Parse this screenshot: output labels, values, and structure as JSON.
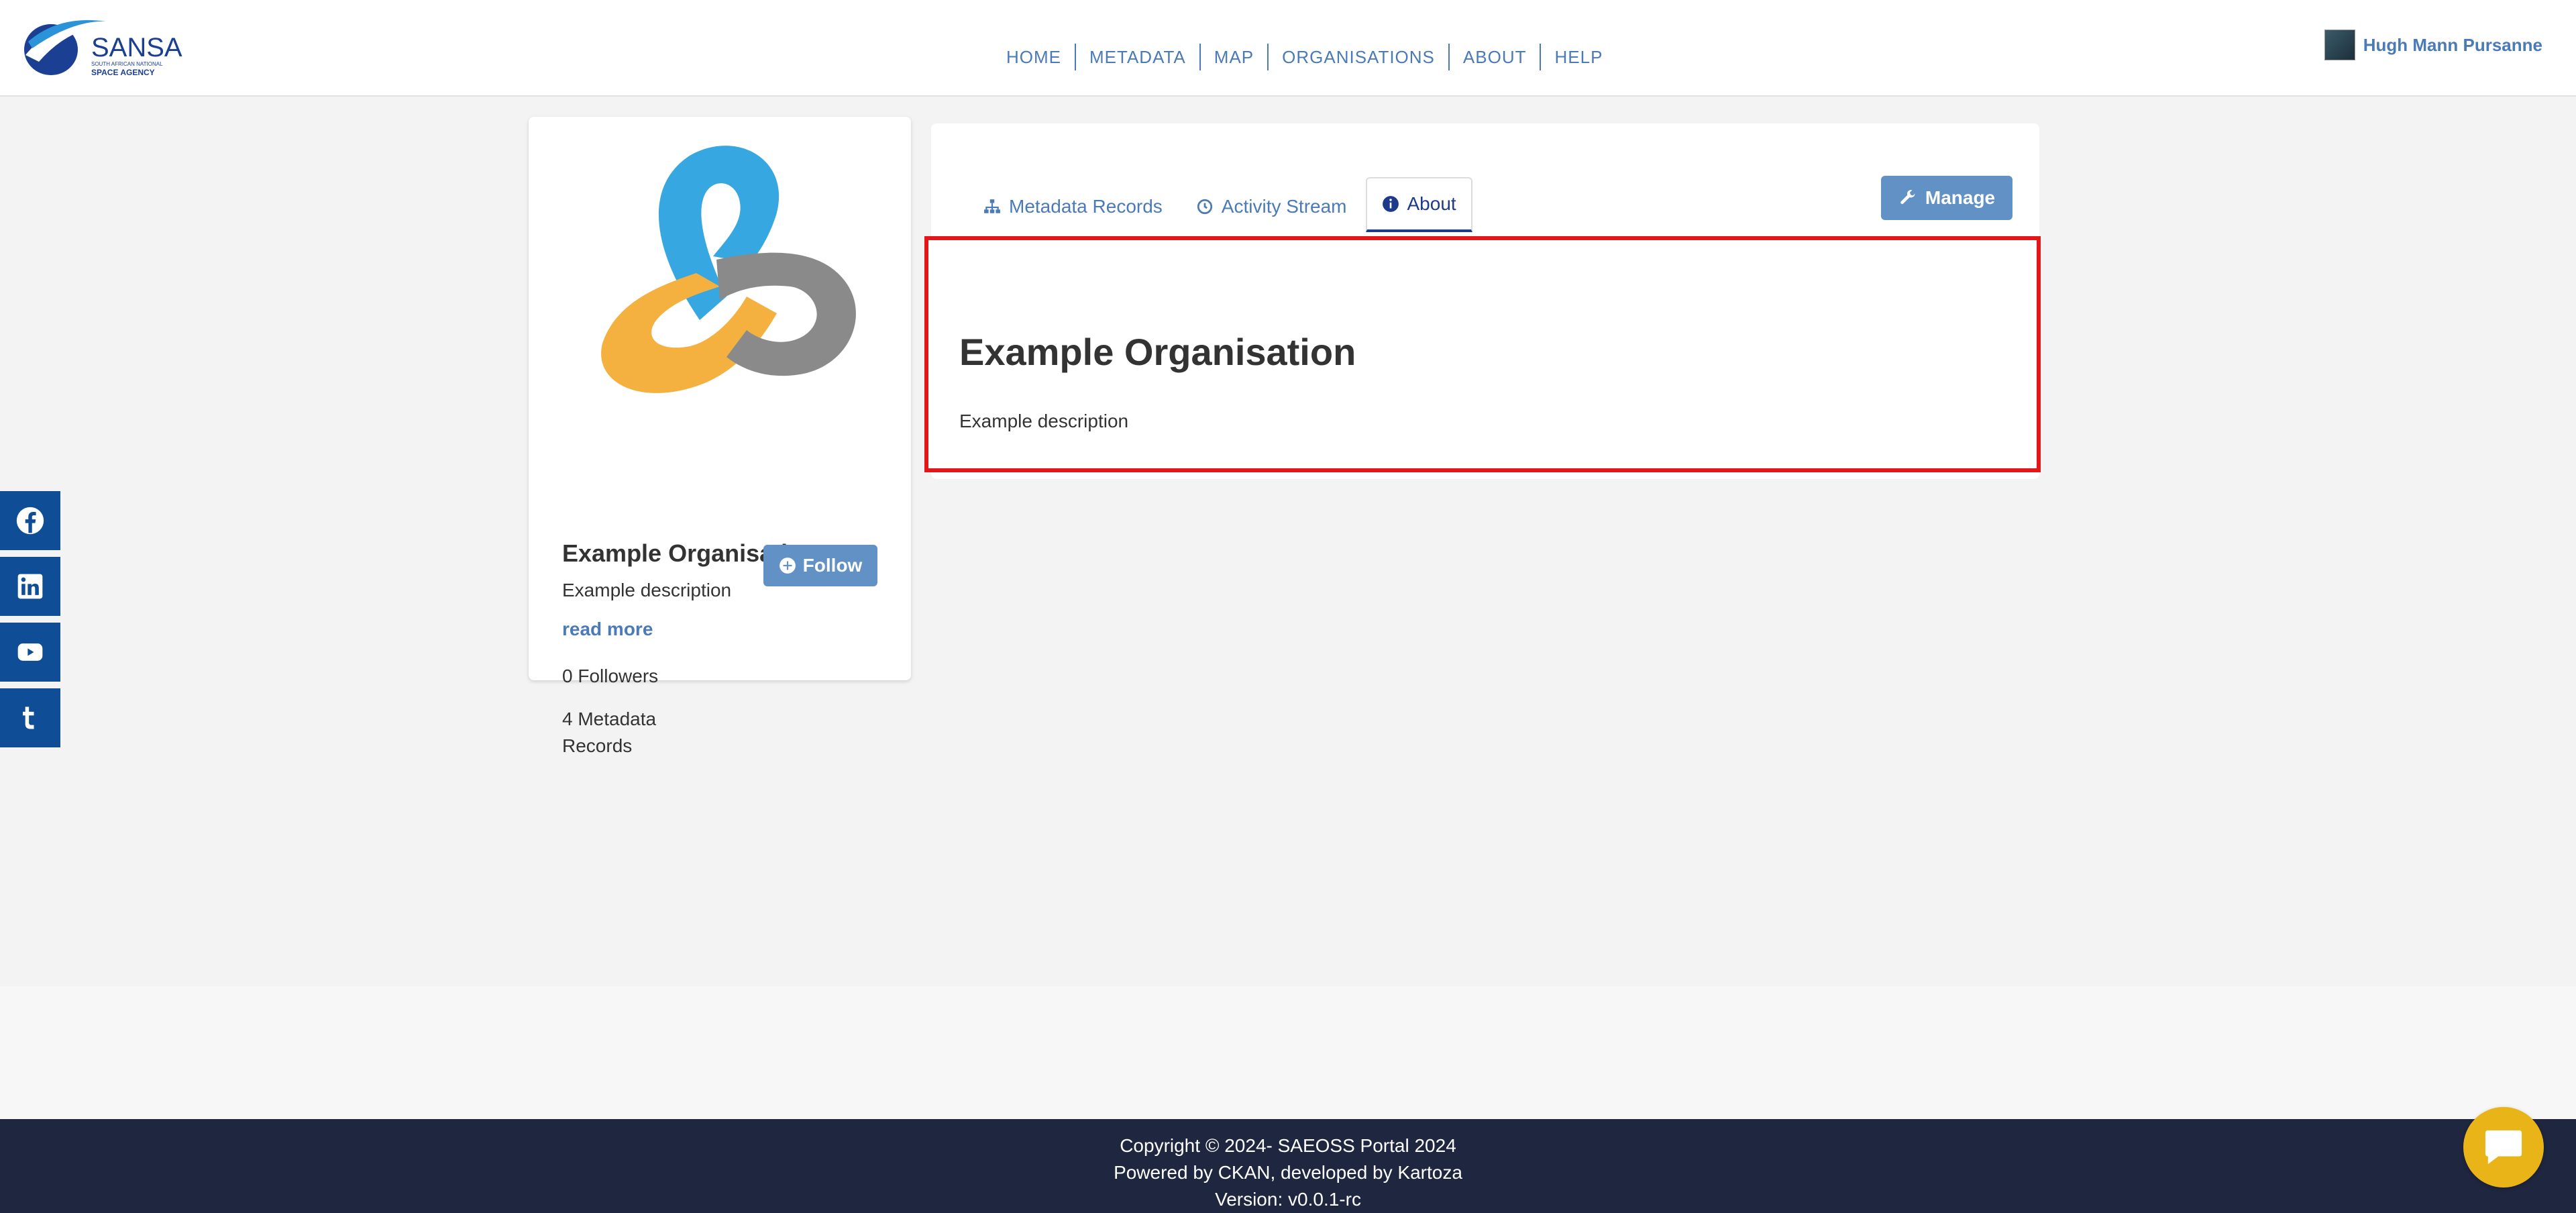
{
  "header": {
    "logo": {
      "name": "SANSA",
      "subtitle_small": "SOUTH AFRICAN NATIONAL",
      "subtitle": "SPACE AGENCY"
    },
    "nav": [
      {
        "label": "HOME"
      },
      {
        "label": "METADATA"
      },
      {
        "label": "MAP"
      },
      {
        "label": "ORGANISATIONS"
      },
      {
        "label": "ABOUT"
      },
      {
        "label": "HELP"
      }
    ],
    "user": {
      "name": "Hugh Mann Pursanne",
      "avatar_icon": "user-avatar"
    }
  },
  "social": [
    {
      "icon": "facebook-icon"
    },
    {
      "icon": "linkedin-icon"
    },
    {
      "icon": "youtube-icon"
    },
    {
      "icon": "tumblr-icon"
    }
  ],
  "org_card": {
    "title": "Example Organisation",
    "description": "Example description",
    "read_more": "read more",
    "followers": "0 Followers",
    "records": "4 Metadata Records",
    "follow_label": "Follow"
  },
  "main": {
    "tabs": [
      {
        "label": "Metadata Records",
        "icon": "sitemap-icon"
      },
      {
        "label": "Activity Stream",
        "icon": "clock-icon"
      },
      {
        "label": "About",
        "icon": "info-icon",
        "active": true
      }
    ],
    "manage_label": "Manage",
    "about": {
      "title": "Example Organisation",
      "description": "Example description"
    }
  },
  "footer": {
    "line1": "Copyright © 2024- SAEOSS Portal 2024",
    "line2": "Powered by CKAN, developed by Kartoza",
    "line3": "Version: v0.0.1-rc"
  },
  "colors": {
    "accent": "#4a7ab8",
    "footer": "#1f2640",
    "highlight": "#e3161a",
    "chat": "#e8b418",
    "social": "#0f4d96"
  }
}
